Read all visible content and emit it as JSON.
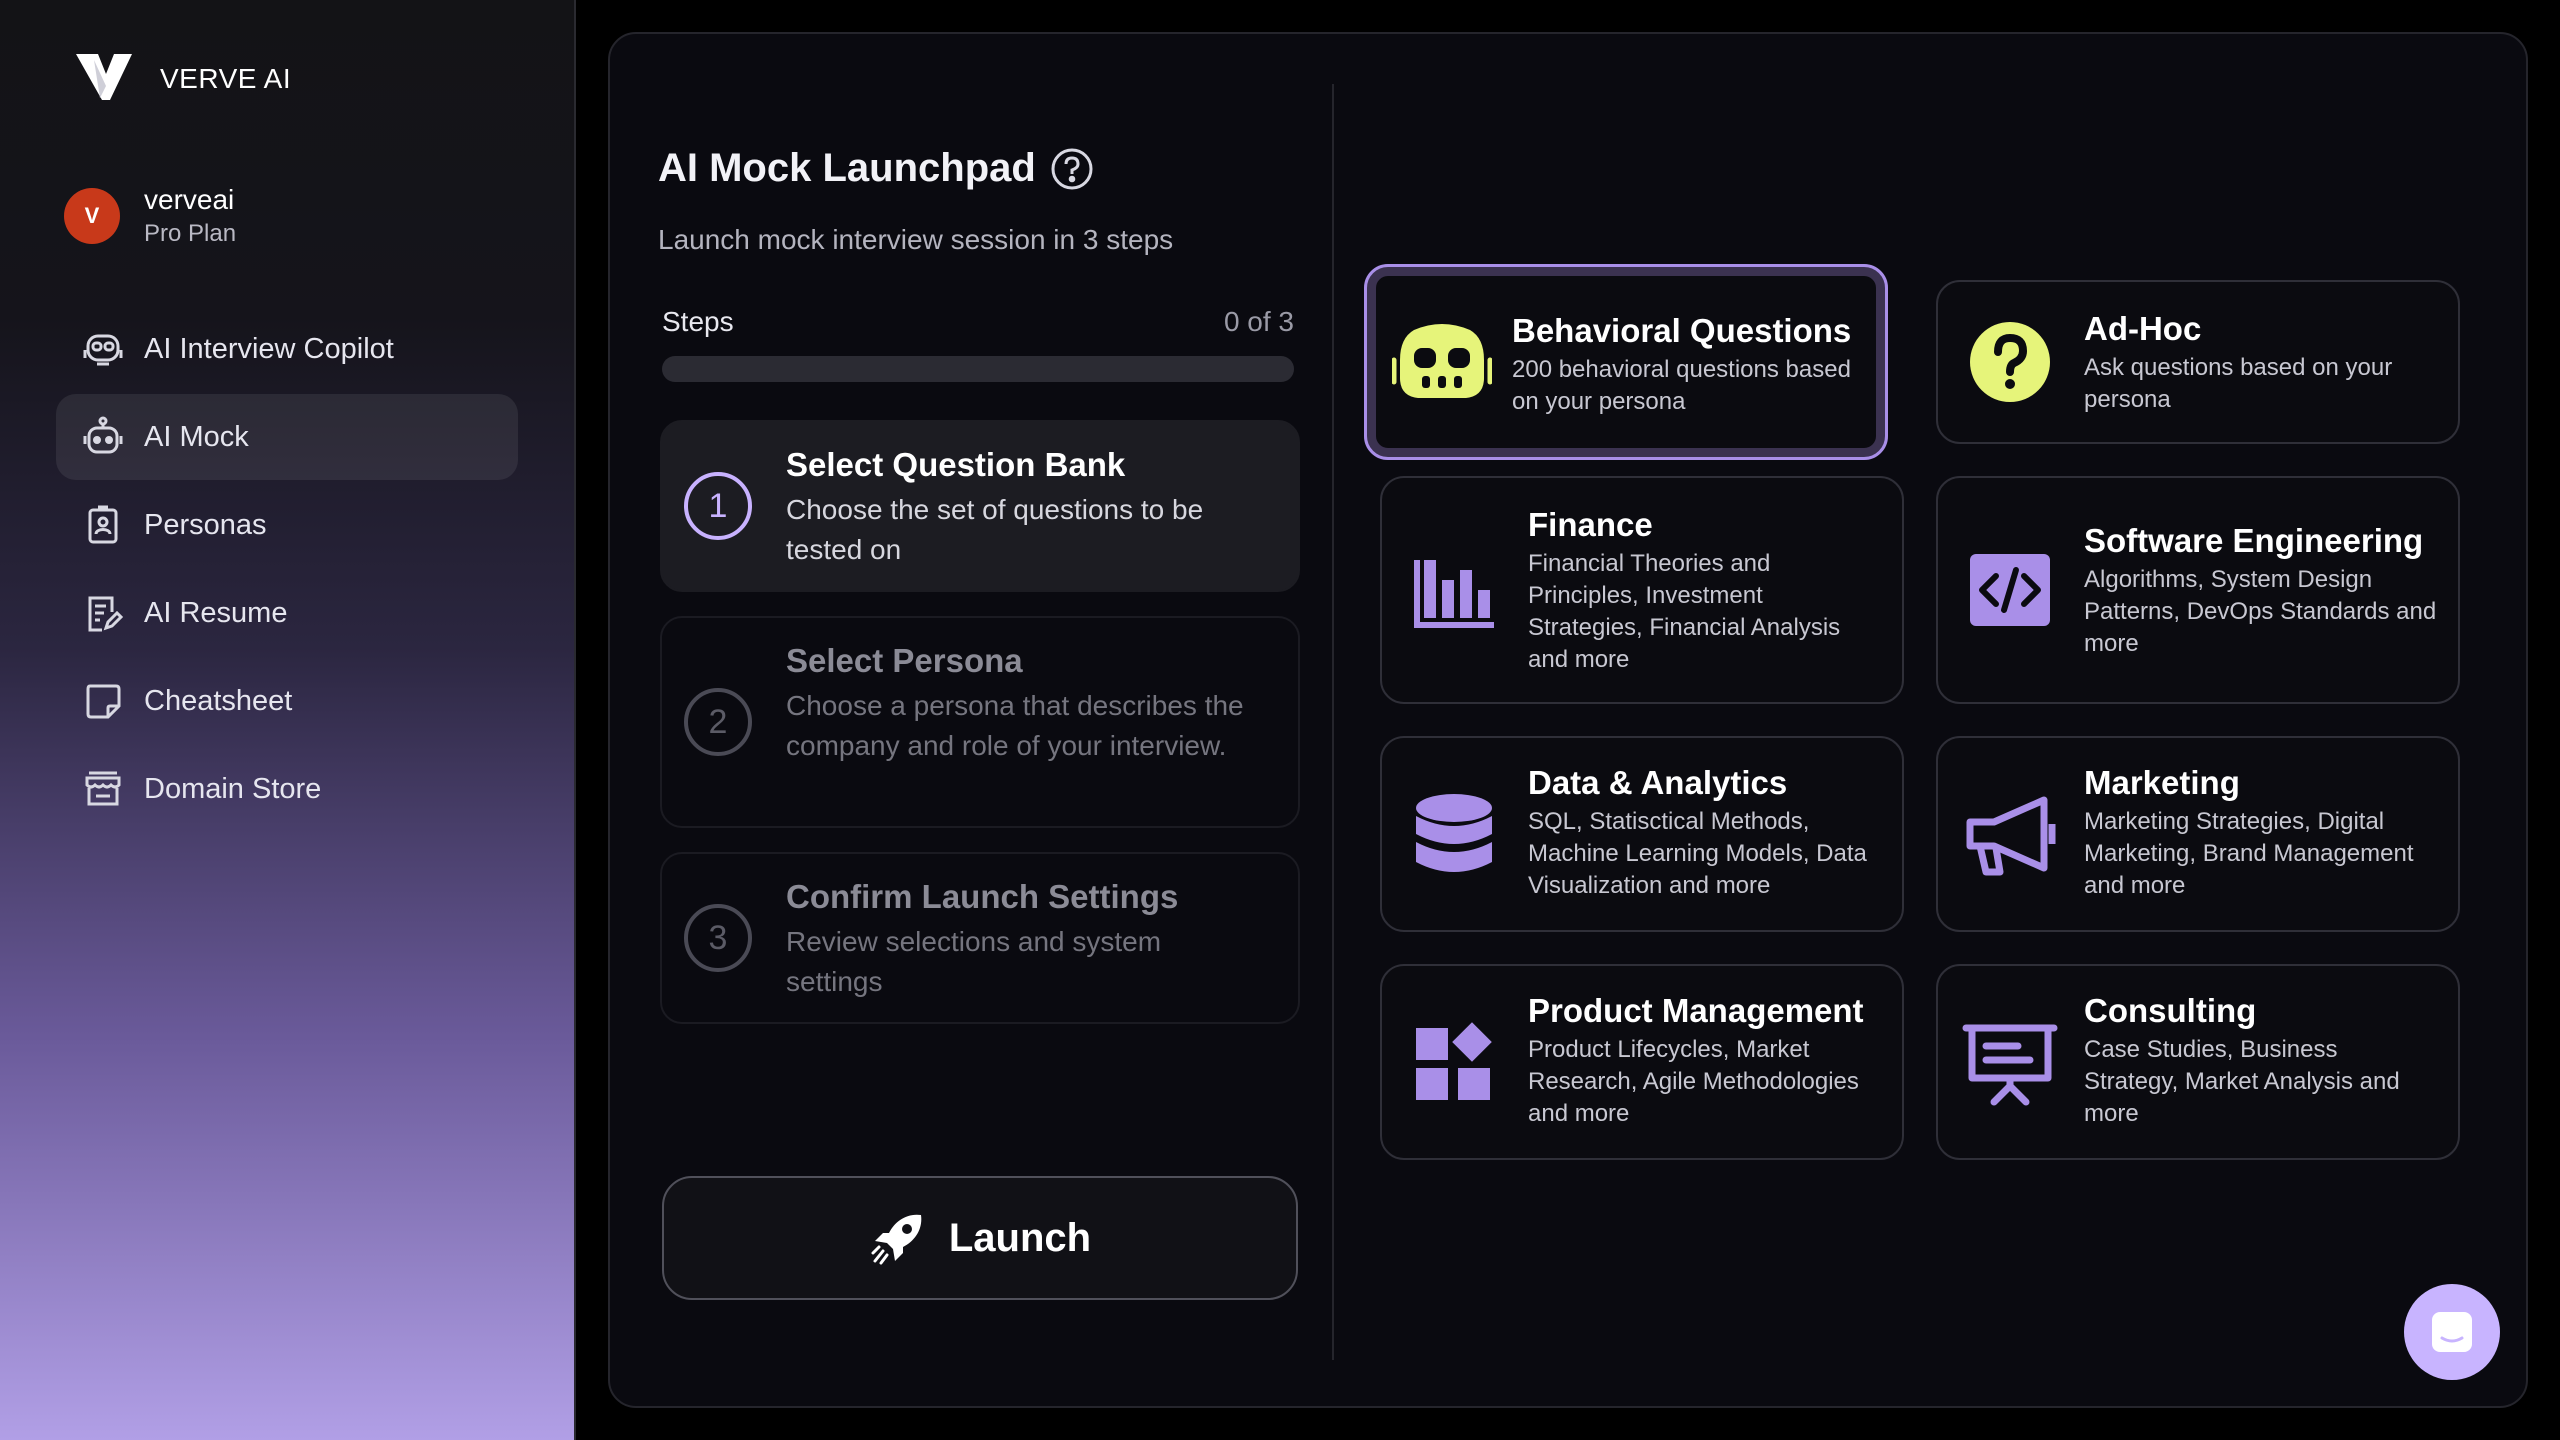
{
  "brand": {
    "name": "VERVE AI"
  },
  "user": {
    "initial": "V",
    "name": "verveai",
    "plan": "Pro Plan"
  },
  "nav": {
    "items": [
      {
        "label": "AI Interview Copilot",
        "icon": "copilot-robot-icon",
        "active": false
      },
      {
        "label": "AI Mock",
        "icon": "mock-robot-icon",
        "active": true
      },
      {
        "label": "Personas",
        "icon": "badge-icon",
        "active": false
      },
      {
        "label": "AI Resume",
        "icon": "document-edit-icon",
        "active": false
      },
      {
        "label": "Cheatsheet",
        "icon": "note-icon",
        "active": false
      },
      {
        "label": "Domain Store",
        "icon": "store-icon",
        "active": false
      }
    ]
  },
  "main": {
    "title": "AI Mock Launchpad",
    "subtitle": "Launch mock interview session in 3 steps",
    "steps_label": "Steps",
    "steps_count": "0 of 3",
    "progress": 0,
    "steps": [
      {
        "number": "1",
        "title": "Select Question Bank",
        "description": "Choose the set of questions to be tested on",
        "current": true
      },
      {
        "number": "2",
        "title": "Select Persona",
        "description": "Choose a persona that describes the company and role of your interview.",
        "current": false
      },
      {
        "number": "3",
        "title": "Confirm Launch Settings",
        "description": "Review selections and system settings",
        "current": false
      }
    ],
    "launch_label": "Launch"
  },
  "question_banks": [
    {
      "title": "Behavioral Questions",
      "description": "200 behavioral questions based on your persona",
      "icon": "robot-face-icon",
      "selected": true
    },
    {
      "title": "Ad-Hoc",
      "description": "Ask questions based on your persona",
      "icon": "question-circle-icon",
      "selected": false
    },
    {
      "title": "Finance",
      "description": "Financial Theories and Principles, Investment Strategies, Financial Analysis and more",
      "icon": "bar-chart-icon",
      "selected": false
    },
    {
      "title": "Software Engineering",
      "description": "Algorithms, System Design Patterns, DevOps Standards and more",
      "icon": "code-icon",
      "selected": false
    },
    {
      "title": "Data & Analytics",
      "description": "SQL, Statisctical Methods, Machine Learning Models, Data Visualization and more",
      "icon": "database-icon",
      "selected": false
    },
    {
      "title": "Marketing",
      "description": "Marketing Strategies, Digital Marketing, Brand Management and more",
      "icon": "megaphone-icon",
      "selected": false
    },
    {
      "title": "Product Management",
      "description": "Product Lifecycles, Market Research, Agile Methodologies and more",
      "icon": "widgets-icon",
      "selected": false
    },
    {
      "title": "Consulting",
      "description": "Case Studies, Business Strategy, Market Analysis and more",
      "icon": "presentation-icon",
      "selected": false
    }
  ],
  "colors": {
    "accent": "#a98fe8",
    "accent_light": "#c8b4ff",
    "yellow": "#e6f47a",
    "avatar": "#c8391a",
    "card_border": "#2f2f38"
  }
}
